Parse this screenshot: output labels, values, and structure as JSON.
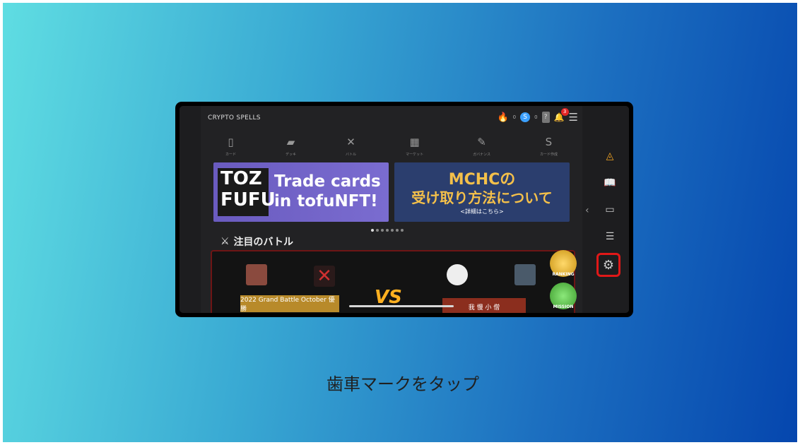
{
  "app": {
    "logo": "CRYPTO SPELLS",
    "counters": {
      "fire": "0",
      "spell": "0",
      "notif": "3"
    }
  },
  "nav": [
    {
      "icon": "▯",
      "label": "カード"
    },
    {
      "icon": "▰",
      "label": "デッキ"
    },
    {
      "icon": "✕",
      "label": "バトル"
    },
    {
      "icon": "▦",
      "label": "マーケット"
    },
    {
      "icon": "✎",
      "label": "ガバナンス"
    },
    {
      "icon": "S",
      "label": "カード作成"
    }
  ],
  "banners": {
    "left": {
      "logo": "TOZ FUFU",
      "line1": "Trade cards",
      "line2": "in tofuNFT!"
    },
    "right": {
      "line1": "MCHCの",
      "line2": "受け取り方法について",
      "line3": "<詳細はこちら>"
    }
  },
  "section": {
    "title": "注目のバトル"
  },
  "battle": {
    "left_plate": "2022 Grand Battle October 優勝",
    "vs": "VS",
    "right_plate": "我 慢 小 僧",
    "ranking": "RANKING",
    "mission": "MISSION"
  },
  "caption": "歯車マークをタップ",
  "colors": {
    "highlight": "#e01818",
    "accent": "#f4c04a"
  }
}
